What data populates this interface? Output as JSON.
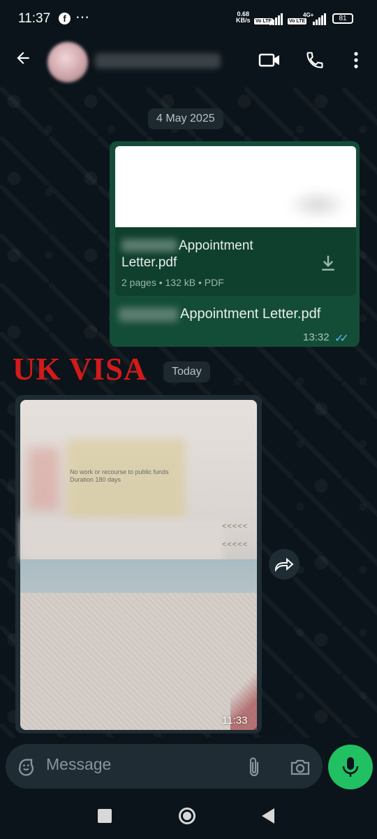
{
  "status_bar": {
    "time": "11:37",
    "overflow": "⋯",
    "net_speed_value": "0.68",
    "net_speed_unit": "KB/s",
    "network_tag": "4G+",
    "battery": "81"
  },
  "header": {
    "back_icon": "arrow-left-icon",
    "video_icon": "video-call-icon",
    "phone_icon": "voice-call-icon",
    "menu_icon": "more-vertical-icon"
  },
  "chat": {
    "date_chip_1": "4 May 2025",
    "document_message": {
      "title": "Appointment Letter.pdf",
      "title_line1": "Appointment",
      "title_line2": "Letter.pdf",
      "meta": "2 pages • 132 kB • PDF",
      "caption": "Appointment Letter.pdf",
      "time": "13:32",
      "status": "read"
    },
    "overlay_text": "UK VISA",
    "date_chip_2": "Today",
    "image_message": {
      "time": "11:33",
      "visible_text": [
        "No work or recourse to public funds",
        "Duration 180 days"
      ],
      "mrz_fragment": "<<<<<"
    }
  },
  "input": {
    "placeholder": "Message"
  },
  "colors": {
    "background": "#0b141a",
    "outgoing_bubble": "#144d37",
    "incoming_bubble": "#1f2c34",
    "accent_green": "#21c063",
    "read_ticks": "#53bdeb",
    "overlay_red": "#d21a1a"
  }
}
